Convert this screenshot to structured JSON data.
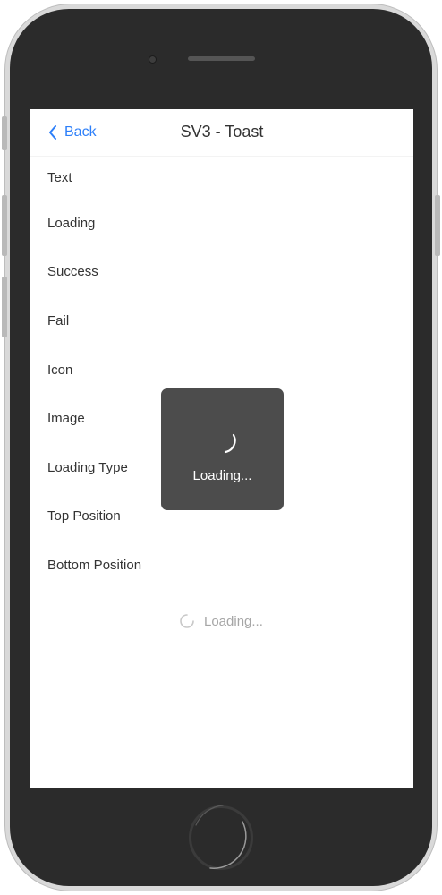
{
  "nav": {
    "back_label": "Back",
    "title": "SV3 - Toast"
  },
  "menu": {
    "items": [
      {
        "label": "Text"
      },
      {
        "label": "Loading"
      },
      {
        "label": "Success"
      },
      {
        "label": "Fail"
      },
      {
        "label": "Icon"
      },
      {
        "label": "Image"
      },
      {
        "label": "Loading Type"
      },
      {
        "label": "Top Position"
      },
      {
        "label": "Bottom Position"
      }
    ]
  },
  "list_footer": {
    "loading_text": "Loading..."
  },
  "toast": {
    "text": "Loading..."
  },
  "colors": {
    "accent": "#2d7ff9",
    "toast_bg": "#4c4c4c",
    "device_body": "#2b2b2b",
    "device_frame": "#d9d9d9"
  },
  "icons": {
    "back": "chevron-left-icon",
    "list_spinner": "loading-spinner-icon",
    "toast_spinner": "loading-spinner-icon"
  }
}
